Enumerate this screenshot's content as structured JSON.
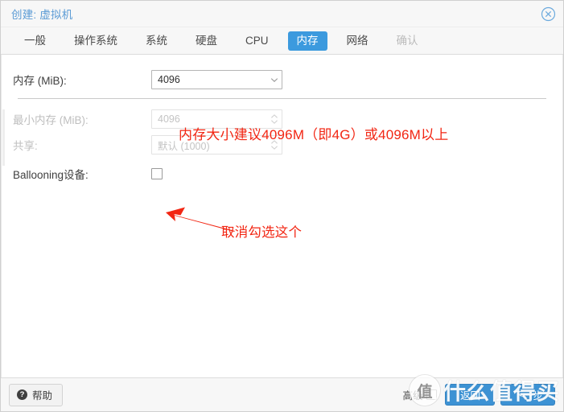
{
  "window": {
    "title": "创建: 虚拟机",
    "close_icon": "close-circle-icon"
  },
  "tabs": [
    {
      "label": "一般",
      "state": "normal"
    },
    {
      "label": "操作系统",
      "state": "normal"
    },
    {
      "label": "系统",
      "state": "normal"
    },
    {
      "label": "硬盘",
      "state": "normal"
    },
    {
      "label": "CPU",
      "state": "normal"
    },
    {
      "label": "内存",
      "state": "active"
    },
    {
      "label": "网络",
      "state": "normal"
    },
    {
      "label": "确认",
      "state": "disabled"
    }
  ],
  "form": {
    "memory": {
      "label": "内存 (MiB):",
      "value": "4096",
      "placeholder": "4096",
      "enabled": true,
      "spinner_icon": "spinner-down-icon"
    },
    "min_memory": {
      "label": "最小内存 (MiB):",
      "value": "4096",
      "placeholder": "4096",
      "enabled": false,
      "spinner_icon": "spinner-updown-icon"
    },
    "shares": {
      "label": "共享:",
      "value": "默认 (1000)",
      "placeholder": "默认 (1000)",
      "enabled": false,
      "spinner_icon": "spinner-updown-icon"
    },
    "ballooning": {
      "label": "Ballooning设备:",
      "checked": false
    }
  },
  "annotations": {
    "memory_note": "内存大小建议4096M（即4G）或4096M以上",
    "uncheck_note": "取消勾选这个",
    "color": "#f22613",
    "arrow_icon": "red-arrow-icon"
  },
  "footer": {
    "help_label": "帮助",
    "help_icon": "question-mark-icon",
    "advanced_label": "高级",
    "advanced_checked": false,
    "back_label": "返回",
    "next_label": "下一步"
  },
  "watermark": {
    "badge_text": "值",
    "text": "什么值得买"
  },
  "colors": {
    "accent": "#3c9ade",
    "title": "#5b9bd5",
    "annotation": "#f22613",
    "button": "#3c92d4"
  }
}
